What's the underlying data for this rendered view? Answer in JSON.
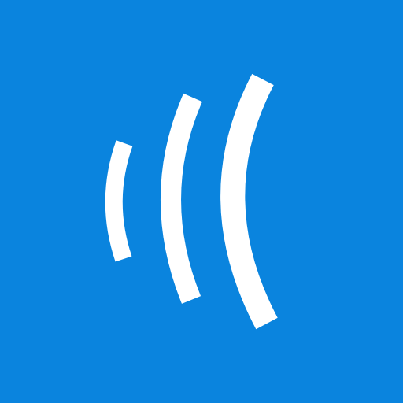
{
  "app_icon": {
    "icon_name": "sound-waves-icon",
    "description_colors": {
      "background": "#0a84de",
      "foreground": "#ffffff"
    },
    "wave_count": 3
  }
}
